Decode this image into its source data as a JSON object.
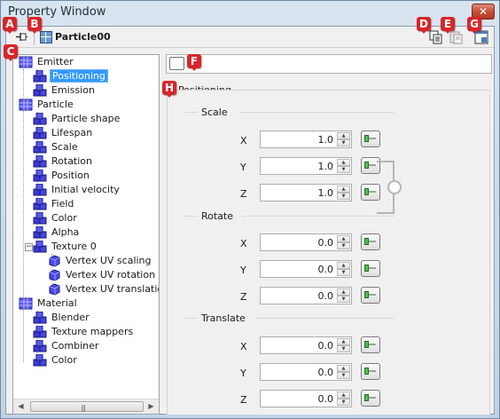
{
  "window": {
    "title": "Property Window",
    "close_symbol": "✕"
  },
  "toolbar": {
    "title": "Particle00"
  },
  "badges": {
    "a": "A",
    "b": "B",
    "c": "C",
    "d": "D",
    "e": "E",
    "f": "F",
    "g": "G",
    "h": "H"
  },
  "tree": {
    "emitter": "Emitter",
    "positioning": "Positioning",
    "emission": "Emission",
    "particle": "Particle",
    "particle_shape": "Particle shape",
    "lifespan": "Lifespan",
    "scale": "Scale",
    "rotation": "Rotation",
    "position": "Position",
    "initial_velocity": "Initial velocity",
    "field": "Field",
    "color": "Color",
    "alpha": "Alpha",
    "texture0": "Texture 0",
    "vertex_uv_scaling": "Vertex UV scaling",
    "vertex_uv_rotation": "Vertex UV rotation",
    "vertex_uv_translation": "Vertex UV translation",
    "material": "Material",
    "blender": "Blender",
    "texture_mappers": "Texture mappers",
    "combiner": "Combiner",
    "material_color": "Color",
    "collapse_symbol": "−"
  },
  "scrollbar": {
    "left_arrow": "◀",
    "right_arrow": "▶",
    "grip": "|||"
  },
  "properties": {
    "section_title": "Positioning",
    "scale": {
      "label": "Scale",
      "x_label": "X",
      "y_label": "Y",
      "z_label": "Z",
      "x": "1.0",
      "y": "1.0",
      "z": "1.0"
    },
    "rotate": {
      "label": "Rotate",
      "x_label": "X",
      "y_label": "Y",
      "z_label": "Z",
      "x": "0.0",
      "y": "0.0",
      "z": "0.0"
    },
    "translate": {
      "label": "Translate",
      "x_label": "X",
      "y_label": "Y",
      "z_label": "Z",
      "x": "0.0",
      "y": "0.0",
      "z": "0.0"
    }
  },
  "spin": {
    "up": "▲",
    "down": "▼"
  },
  "colors": {
    "badge": "#d6262a",
    "selection": "#3399ff",
    "node_icon": "#3b3bd1"
  }
}
